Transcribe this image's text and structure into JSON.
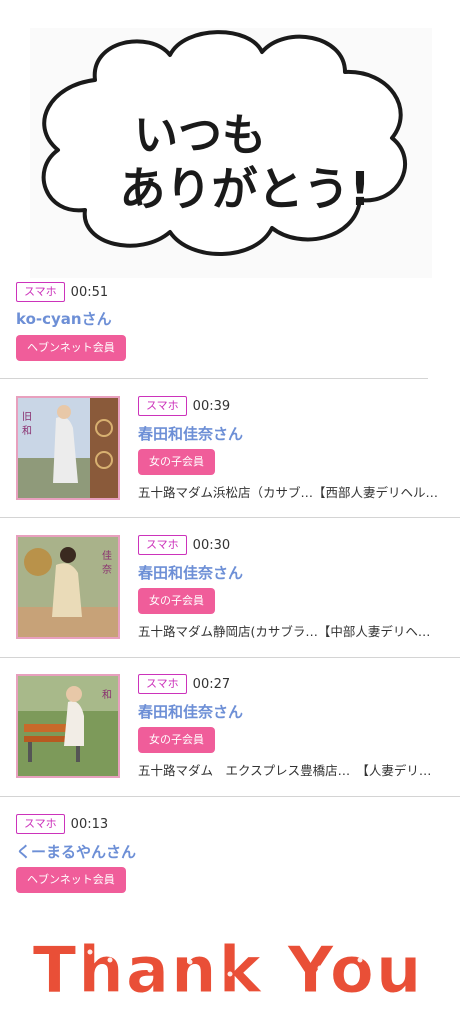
{
  "banner": {
    "text_line1": "いつも",
    "text_line2": "ありがとう!"
  },
  "entries": [
    {
      "device": "スマホ",
      "time": "00:51",
      "name": "ko-cyanさん",
      "tag": "ヘブンネット会員"
    },
    {
      "device": "スマホ",
      "time": "00:39",
      "name": "春田和佳奈さん",
      "tag": "女の子会員",
      "shop": "五十路マダム浜松店（カサブ…【西部人妻デリヘル…"
    },
    {
      "device": "スマホ",
      "time": "00:30",
      "name": "春田和佳奈さん",
      "tag": "女の子会員",
      "shop": "五十路マダム静岡店(カサブラ…【中部人妻デリヘ…"
    },
    {
      "device": "スマホ",
      "time": "00:27",
      "name": "春田和佳奈さん",
      "tag": "女の子会員",
      "shop": "五十路マダム　エクスプレス豊橋店…　【人妻デリ…"
    },
    {
      "device": "スマホ",
      "time": "00:13",
      "name": "くーまるやんさん",
      "tag": "ヘブンネット会員"
    }
  ],
  "footer": {
    "thanks_text": "Thank You"
  },
  "colors": {
    "accent_pink": "#f05d9a",
    "name_blue": "#6d8fd6",
    "device_border": "#cc33bb"
  }
}
